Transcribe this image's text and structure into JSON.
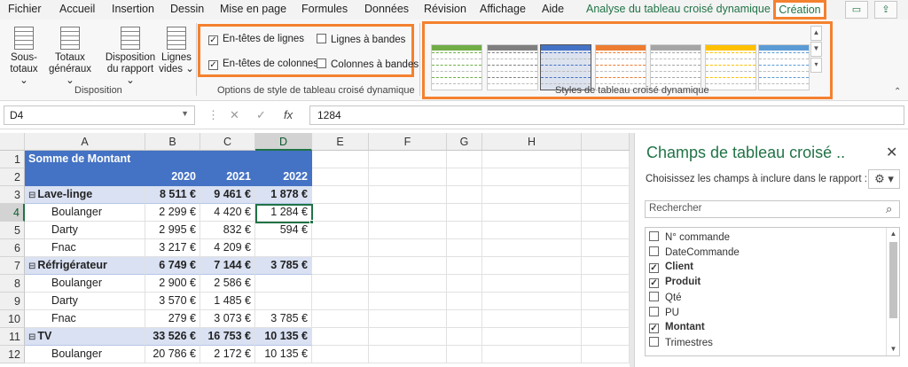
{
  "menu": {
    "tabs": [
      "Fichier",
      "Accueil",
      "Insertion",
      "Dessin",
      "Mise en page",
      "Formules",
      "Données",
      "Révision",
      "Affichage",
      "Aide",
      "Analyse du tableau croisé dynamique"
    ],
    "active_tab": "Création"
  },
  "ribbon": {
    "disposition": {
      "sous_totaux": [
        "Sous-",
        "totaux ⌄"
      ],
      "totaux_generaux": [
        "Totaux",
        "généraux ⌄"
      ],
      "disposition_rapport": [
        "Disposition",
        "du rapport ⌄"
      ],
      "lignes_vides": [
        "Lignes",
        "vides ⌄"
      ],
      "group_label": "Disposition"
    },
    "options": {
      "entetes_lignes": "En-têtes de lignes",
      "entetes_colonnes": "En-têtes de colonnes",
      "lignes_bandes": "Lignes à bandes",
      "colonnes_bandes": "Colonnes à bandes",
      "group_label": "Options de style de tableau croisé dynamique"
    },
    "styles": {
      "group_label": "Styles de tableau croisé dynamique",
      "colors": [
        "#70ad47",
        "#7f7f7f",
        "#4472c4",
        "#ed7d31",
        "#a5a5a5",
        "#ffc000",
        "#5b9bd5"
      ]
    }
  },
  "formula_bar": {
    "name_box": "D4",
    "formula": "1284"
  },
  "grid": {
    "columns": [
      "A",
      "B",
      "C",
      "D",
      "E",
      "F",
      "G",
      "H"
    ],
    "rows": [
      "1",
      "2",
      "3",
      "4",
      "5",
      "6",
      "7",
      "8",
      "9",
      "10",
      "11",
      "12"
    ],
    "cells": {
      "r1": {
        "a": "Somme de Montant"
      },
      "r2": {
        "b": "2020",
        "c": "2021",
        "d": "2022"
      },
      "r3": {
        "a": "Lave-linge",
        "b": "8 511 €",
        "c": "9 461 €",
        "d": "1 878 €"
      },
      "r4": {
        "a": "Boulanger",
        "b": "2 299 €",
        "c": "4 420 €",
        "d": "1 284 €"
      },
      "r5": {
        "a": "Darty",
        "b": "2 995 €",
        "c": "832 €",
        "d": "594 €"
      },
      "r6": {
        "a": "Fnac",
        "b": "3 217 €",
        "c": "4 209 €",
        "d": ""
      },
      "r7": {
        "a": "Réfrigérateur",
        "b": "6 749 €",
        "c": "7 144 €",
        "d": "3 785 €"
      },
      "r8": {
        "a": "Boulanger",
        "b": "2 900 €",
        "c": "2 586 €",
        "d": ""
      },
      "r9": {
        "a": "Darty",
        "b": "3 570 €",
        "c": "1 485 €",
        "d": ""
      },
      "r10": {
        "a": "Fnac",
        "b": "279 €",
        "c": "3 073 €",
        "d": "3 785 €"
      },
      "r11": {
        "a": "TV",
        "b": "33 526 €",
        "c": "16 753 €",
        "d": "10 135 €"
      },
      "r12": {
        "a": "Boulanger",
        "b": "20 786 €",
        "c": "2 172 €",
        "d": "10 135 €"
      }
    }
  },
  "pane": {
    "title": "Champs de tableau croisé ..",
    "instructions": "Choisissez les champs à inclure dans le rapport :",
    "search_placeholder": "Rechercher",
    "fields": [
      {
        "label": "N° commande",
        "checked": false
      },
      {
        "label": "DateCommande",
        "checked": false
      },
      {
        "label": "Client",
        "checked": true
      },
      {
        "label": "Produit",
        "checked": true
      },
      {
        "label": "Qté",
        "checked": false
      },
      {
        "label": "PU",
        "checked": false
      },
      {
        "label": "Montant",
        "checked": true
      },
      {
        "label": "Trimestres",
        "checked": false
      }
    ]
  }
}
